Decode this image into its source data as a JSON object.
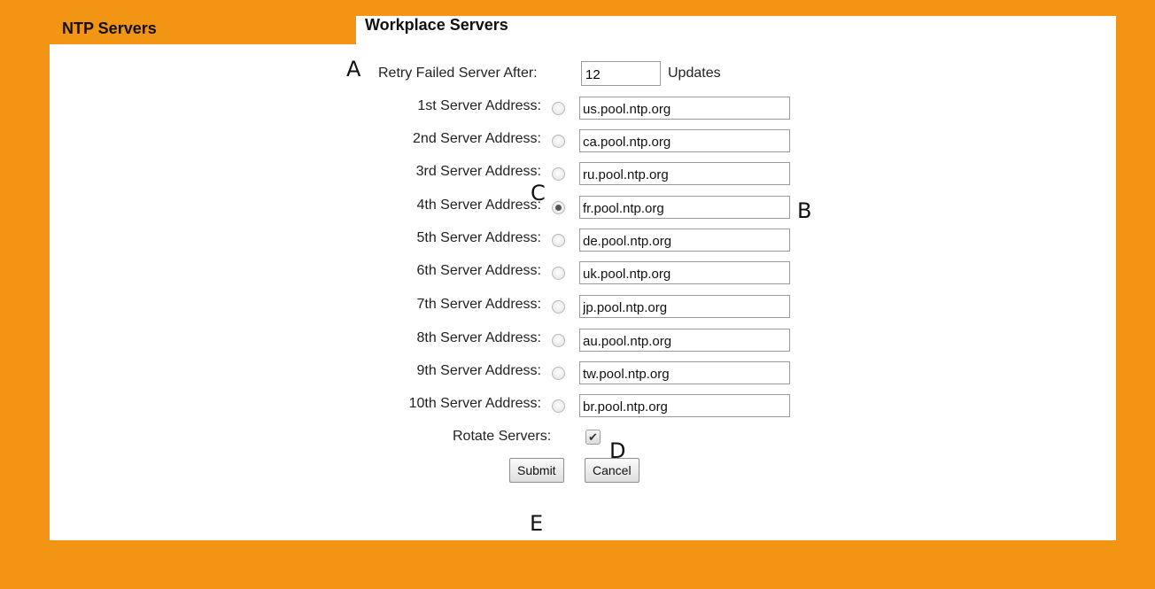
{
  "tabs": {
    "active_label": "NTP Servers",
    "inactive_label": "Workplace Servers"
  },
  "retry": {
    "label": "Retry Failed Server After:",
    "value": "12",
    "unit": "Updates"
  },
  "servers": [
    {
      "label": "1st Server Address:",
      "value": "us.pool.ntp.org",
      "selected": false
    },
    {
      "label": "2nd Server Address:",
      "value": "ca.pool.ntp.org",
      "selected": false
    },
    {
      "label": "3rd Server Address:",
      "value": "ru.pool.ntp.org",
      "selected": false
    },
    {
      "label": "4th Server Address:",
      "value": "fr.pool.ntp.org",
      "selected": true
    },
    {
      "label": "5th Server Address:",
      "value": "de.pool.ntp.org",
      "selected": false
    },
    {
      "label": "6th Server Address:",
      "value": "uk.pool.ntp.org",
      "selected": false
    },
    {
      "label": "7th Server Address:",
      "value": "jp.pool.ntp.org",
      "selected": false
    },
    {
      "label": "8th Server Address:",
      "value": "au.pool.ntp.org",
      "selected": false
    },
    {
      "label": "9th Server Address:",
      "value": "tw.pool.ntp.org",
      "selected": false
    },
    {
      "label": "10th Server Address:",
      "value": "br.pool.ntp.org",
      "selected": false
    }
  ],
  "rotate": {
    "label": "Rotate Servers:",
    "checked": true
  },
  "buttons": {
    "submit": "Submit",
    "cancel": "Cancel"
  },
  "markers": {
    "a": "A",
    "b": "B",
    "c": "C",
    "d": "D",
    "e": "E"
  },
  "colors": {
    "frame": "#f29515",
    "panel": "#ffffff"
  }
}
